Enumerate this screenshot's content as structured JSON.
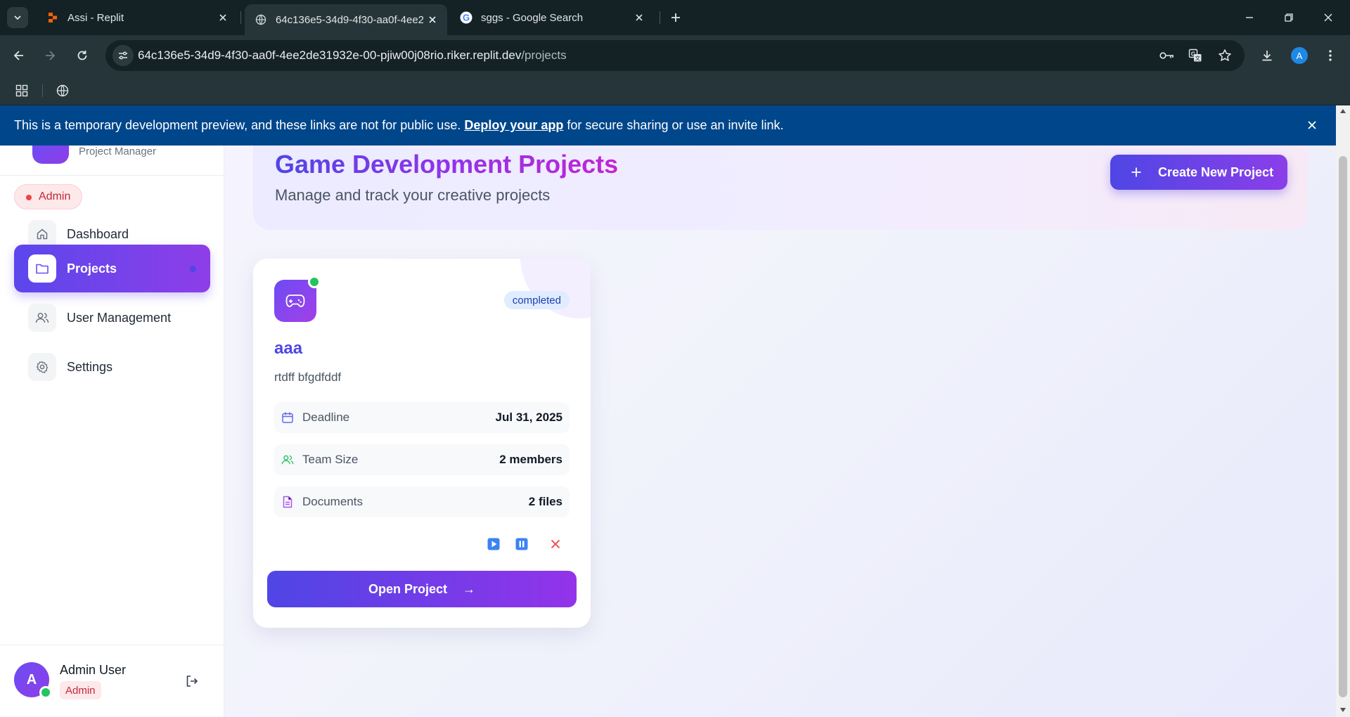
{
  "browser": {
    "tabs": [
      {
        "title": "Assi - Replit",
        "active": false
      },
      {
        "title": "64c136e5-34d9-4f30-aa0f-4ee2",
        "active": true
      },
      {
        "title": "sggs - Google Search",
        "active": false
      }
    ],
    "url_host": "64c136e5-34d9-4f30-aa0f-4ee2de31932e-00-pjiw00j08rio.riker.replit.dev",
    "url_path": "/projects",
    "profile_initial": "A"
  },
  "banner": {
    "text_before": "This is a temporary development preview, and these links are not for public use.",
    "link_text": "Deploy your app",
    "text_after": "for secure sharing or use an invite link."
  },
  "sidebar": {
    "brand_subtitle": "Project Manager",
    "role_badge": "Admin",
    "items": [
      {
        "label": "Dashboard",
        "icon": "home-icon",
        "active": false
      },
      {
        "label": "Projects",
        "icon": "folder-icon",
        "active": true
      },
      {
        "label": "User Management",
        "icon": "users-icon",
        "active": false
      },
      {
        "label": "Settings",
        "icon": "gear-icon",
        "active": false
      }
    ],
    "user": {
      "initial": "A",
      "name": "Admin User",
      "role": "Admin"
    }
  },
  "header": {
    "title": "Game Development Projects",
    "subtitle": "Manage and track your creative projects",
    "create_label": "Create New Project"
  },
  "project": {
    "status": "completed",
    "name": "aaa",
    "description": "rtdff bfgdfddf",
    "rows": [
      {
        "label": "Deadline",
        "value": "Jul 31, 2025",
        "icon": "calendar-icon"
      },
      {
        "label": "Team Size",
        "value": "2 members",
        "icon": "users-icon"
      },
      {
        "label": "Documents",
        "value": "2 files",
        "icon": "document-icon"
      }
    ],
    "open_label": "Open Project",
    "open_arrow": "→"
  },
  "colors": {
    "accent": "#5b47ec",
    "accent_end": "#9333ea",
    "banner": "#00468b",
    "status_online": "#22c55e",
    "danger": "#ef4444"
  }
}
